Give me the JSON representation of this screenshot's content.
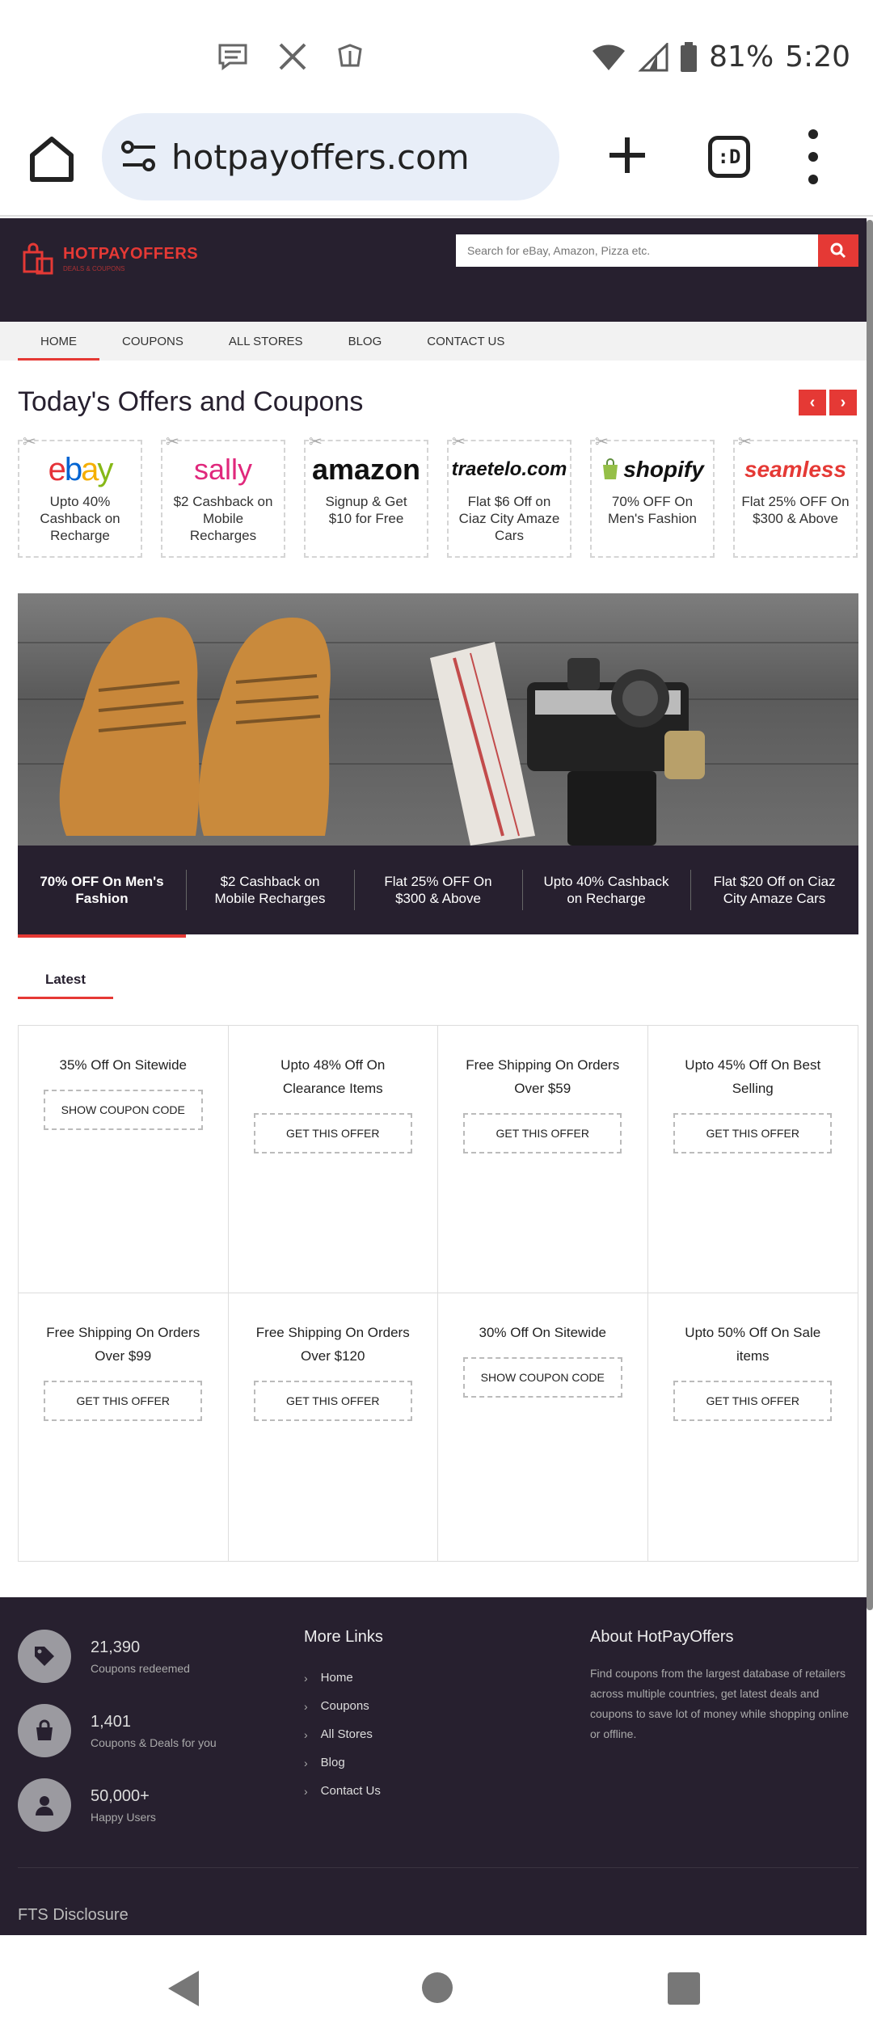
{
  "status": {
    "battery": "81%",
    "time": "5:20"
  },
  "browser": {
    "url": "hotpayoffers.com",
    "tabs_label": ":D"
  },
  "site": {
    "logo": "HOTPAYOFFERS",
    "logo_sub": "DEALS & COUPONS",
    "search_placeholder": "Search for eBay, Amazon, Pizza etc."
  },
  "nav": [
    "HOME",
    "COUPONS",
    "ALL STORES",
    "BLOG",
    "CONTACT US"
  ],
  "offers": {
    "title": "Today's Offers and Coupons",
    "prev": "‹",
    "next": "›",
    "cards": [
      {
        "brand": "ebay",
        "text": "Upto 40% Cashback on Recharge"
      },
      {
        "brand": "sally",
        "text": "$2 Cashback on Mobile Recharges"
      },
      {
        "brand": "amazon",
        "text": "Signup & Get $10 for Free"
      },
      {
        "brand": "traetelo.com",
        "text": "Flat $6 Off on Ciaz City Amaze Cars"
      },
      {
        "brand": "shopify",
        "text": "70% OFF On Men's Fashion"
      },
      {
        "brand": "seamless",
        "text": "Flat 25% OFF On $300 & Above"
      }
    ]
  },
  "hero": {
    "items": [
      "70% OFF On Men's Fashion",
      "$2 Cashback on Mobile Recharges",
      "Flat 25% OFF On $300 & Above",
      "Upto 40% Cashback on Recharge",
      "Flat $20 Off on Ciaz City Amaze Cars"
    ]
  },
  "latest": {
    "tab": "Latest",
    "cells": [
      {
        "title": "35% Off On Sitewide",
        "button": "SHOW COUPON CODE"
      },
      {
        "title": "Upto 48% Off On Clearance Items",
        "button": "GET THIS OFFER"
      },
      {
        "title": "Free Shipping On Orders Over $59",
        "button": "GET THIS OFFER"
      },
      {
        "title": "Upto 45% Off On Best Selling",
        "button": "GET THIS OFFER"
      },
      {
        "title": "Free Shipping On Orders Over $99",
        "button": "GET THIS OFFER"
      },
      {
        "title": "Free Shipping On Orders Over $120",
        "button": "GET THIS OFFER"
      },
      {
        "title": "30% Off On Sitewide",
        "button": "SHOW COUPON CODE"
      },
      {
        "title": "Upto 50% Off On Sale items",
        "button": "GET THIS OFFER"
      }
    ]
  },
  "footer": {
    "stats": [
      {
        "num": "21,390",
        "label": "Coupons redeemed",
        "icon": "tag-icon"
      },
      {
        "num": "1,401",
        "label": "Coupons & Deals for you",
        "icon": "bag-icon"
      },
      {
        "num": "50,000+",
        "label": "Happy Users",
        "icon": "user-icon"
      }
    ],
    "links_title": "More Links",
    "links": [
      "Home",
      "Coupons",
      "All Stores",
      "Blog",
      "Contact Us"
    ],
    "about_title": "About HotPayOffers",
    "about_text": "Find coupons from the largest database of retailers across multiple countries, get latest deals and coupons to save lot of money while shopping online or offline.",
    "fts": "FTS Disclosure"
  },
  "colors": {
    "accent": "#e53935",
    "dark": "#27202f"
  }
}
